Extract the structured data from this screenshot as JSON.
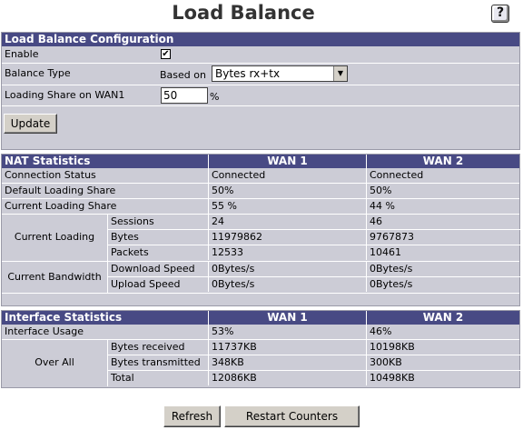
{
  "page": {
    "title": "Load Balance",
    "help_label": "?"
  },
  "config": {
    "header": "Load Balance Configuration",
    "enable_label": "Enable",
    "enable_checked": true,
    "balance_type_label": "Balance Type",
    "based_on_label": "Based on",
    "balance_type_value": "Bytes rx+tx",
    "loading_share_label": "Loading Share on WAN1",
    "loading_share_value": "50",
    "loading_share_unit": "%",
    "update_label": "Update"
  },
  "nat": {
    "header": "NAT Statistics",
    "wan1_header": "WAN 1",
    "wan2_header": "WAN 2",
    "connection_status": {
      "label": "Connection Status",
      "wan1": "Connected",
      "wan2": "Connected"
    },
    "default_share": {
      "label": "Default Loading Share",
      "wan1": "50%",
      "wan2": "50%"
    },
    "current_share": {
      "label": "Current Loading Share",
      "wan1": "55 %",
      "wan2": "44 %"
    },
    "current_loading": {
      "label": "Current Loading",
      "sessions": {
        "label": "Sessions",
        "wan1": "24",
        "wan2": "46"
      },
      "bytes": {
        "label": "Bytes",
        "wan1": "11979862",
        "wan2": "9767873"
      },
      "packets": {
        "label": "Packets",
        "wan1": "12533",
        "wan2": "10461"
      }
    },
    "current_bandwidth": {
      "label": "Current Bandwidth",
      "download": {
        "label": "Download Speed",
        "wan1": "0Bytes/s",
        "wan2": "0Bytes/s"
      },
      "upload": {
        "label": "Upload Speed",
        "wan1": "0Bytes/s",
        "wan2": "0Bytes/s"
      }
    }
  },
  "iface": {
    "header": "Interface Statistics",
    "wan1_header": "WAN 1",
    "wan2_header": "WAN 2",
    "usage": {
      "label": "Interface Usage",
      "wan1": "53%",
      "wan2": "46%"
    },
    "over_all": {
      "label": "Over All",
      "received": {
        "label": "Bytes received",
        "wan1": "11737KB",
        "wan2": "10198KB"
      },
      "transmitted": {
        "label": "Bytes transmitted",
        "wan1": "348KB",
        "wan2": "300KB"
      },
      "total": {
        "label": "Total",
        "wan1": "12086KB",
        "wan2": "10498KB"
      }
    }
  },
  "footer": {
    "refresh_label": "Refresh",
    "restart_label": "Restart Counters"
  }
}
